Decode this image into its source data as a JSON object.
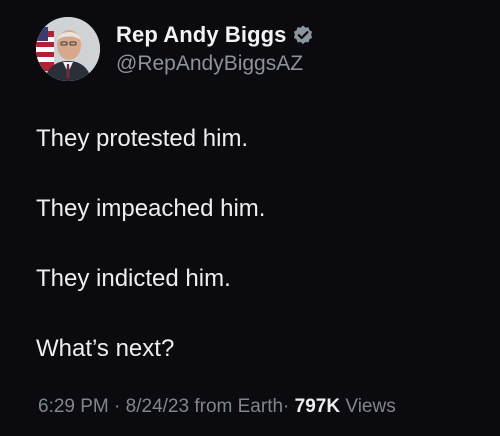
{
  "tweet": {
    "display_name": "Rep Andy Biggs",
    "handle": "@RepAndyBiggsAZ",
    "verified_icon": "verified-badge-icon",
    "lines": [
      "They protested him.",
      "They impeached him.",
      "They indicted him.",
      "What’s next?"
    ],
    "meta": {
      "time": "6:29 PM",
      "sep1": "·",
      "date": "8/24/23",
      "source": "from Earth",
      "sep2": "·",
      "views_count": "797K",
      "views_label": "Views"
    }
  },
  "colors": {
    "background": "#0a0a0f",
    "text": "#eceeef",
    "secondary_text": "#8b949b",
    "verified_badge": "#8a95a0"
  }
}
